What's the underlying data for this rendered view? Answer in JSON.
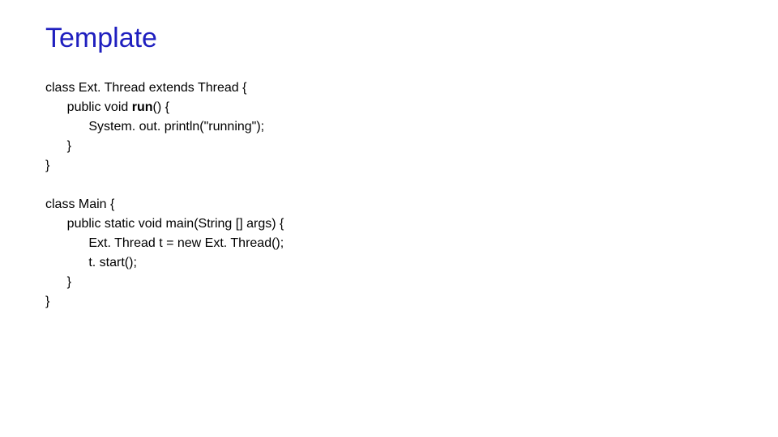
{
  "title": "Template",
  "code1": {
    "l1": "class Ext. Thread extends Thread {",
    "l2_pre": "      public void ",
    "l2_bold": "run",
    "l2_post": "() {",
    "l3": "            System. out. println(\"running\");",
    "l4": "      }",
    "l5": "}"
  },
  "code2": {
    "l1": "class Main {",
    "l2": "      public static void main(String [] args) {",
    "l3": "            Ext. Thread t = new Ext. Thread();",
    "l4": "            t. start();",
    "l5": "      }",
    "l6": "}"
  }
}
